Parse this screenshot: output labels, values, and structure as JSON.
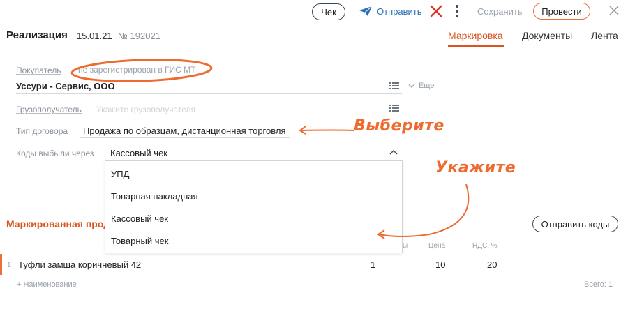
{
  "toolbar": {
    "check_label": "Чек",
    "send_label": "Отправить",
    "save_label": "Сохранить",
    "post_label": "Провести"
  },
  "header": {
    "title": "Реализация",
    "date": "15.01.21",
    "number": "№ 192021",
    "tabs": [
      {
        "label": "Маркировка",
        "active": true
      },
      {
        "label": "Документы",
        "active": false
      },
      {
        "label": "Лента",
        "active": false
      }
    ]
  },
  "form": {
    "buyer_label": "Покупатель",
    "buyer_status": "не зарегистрирован в ГИС МТ",
    "buyer_value": "Уссури - Сервис, ООО",
    "more_label": "Еще",
    "consignee_label": "Грузополучатель",
    "consignee_placeholder": "Укажите грузополучателя",
    "contract_label": "Тип договора",
    "contract_value": "Продажа по образцам, дистанционная торговля",
    "codes_label": "Коды выбыли через",
    "codes_value": "Кассовый чек"
  },
  "dropdown": {
    "options": [
      "УПД",
      "Товарная накладная",
      "Кассовый чек",
      "Товарный чек"
    ]
  },
  "section": {
    "title": "Маркированная проду",
    "send_codes_label": "Отправить коды",
    "col_qty_partial": "ы",
    "col_price": "Цена",
    "col_vat": "НДС, %"
  },
  "table": {
    "rows": [
      {
        "index": "1",
        "name": "Туфли замша коричневый 42",
        "qty": "1",
        "price": "10",
        "vat": "20"
      }
    ],
    "add_label": "+ Наименование",
    "total_label": "Всего: 1"
  },
  "annotations": {
    "select_note": "Выберите",
    "specify_note": "Укажите"
  },
  "colors": {
    "accent": "#d8551f",
    "annotation": "#ef6a2e",
    "link_blue": "#2a6fb5"
  }
}
